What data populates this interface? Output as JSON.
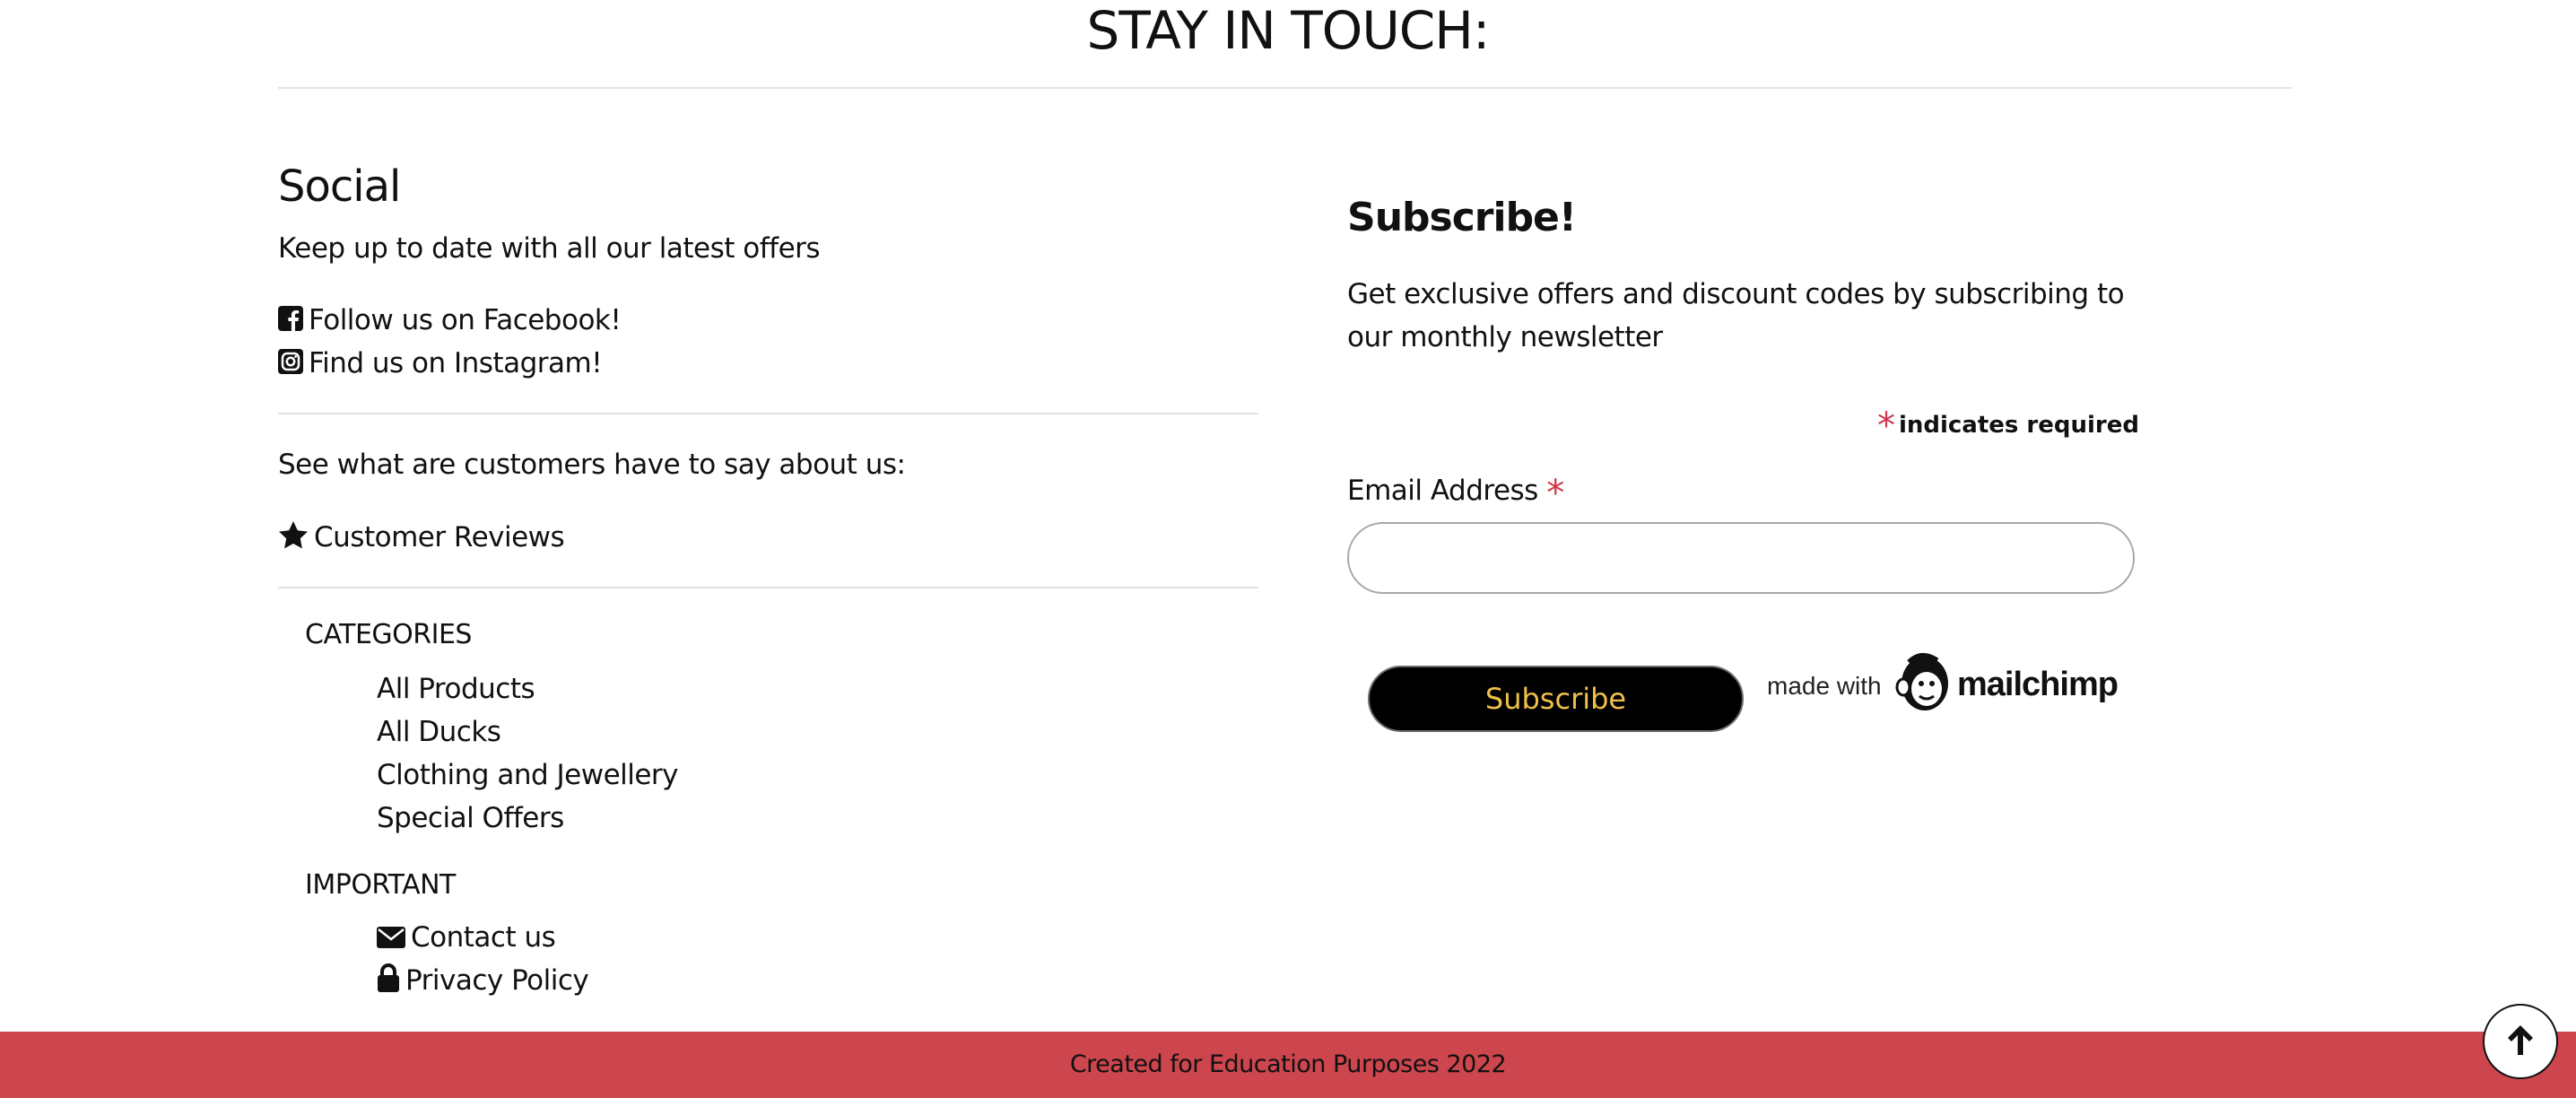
{
  "page": {
    "title": "STAY IN TOUCH:"
  },
  "social": {
    "heading": "Social",
    "tagline": "Keep up to date with all our latest offers",
    "links": [
      {
        "icon": "facebook-icon",
        "label": "Follow us on Facebook!"
      },
      {
        "icon": "instagram-icon",
        "label": "Find us on Instagram!"
      }
    ],
    "reviews_prompt": "See what are customers have to say about us:",
    "reviews_link": {
      "icon": "star-icon",
      "label": "Customer Reviews"
    }
  },
  "categories": {
    "heading": "CATEGORIES",
    "items": [
      "All Products",
      "All Ducks",
      "Clothing and Jewellery",
      "Special Offers"
    ]
  },
  "important": {
    "heading": "IMPORTANT",
    "items": [
      {
        "icon": "envelope-icon",
        "label": "Contact us"
      },
      {
        "icon": "lock-icon",
        "label": "Privacy Policy"
      }
    ]
  },
  "subscribe": {
    "heading": "Subscribe!",
    "description": "Get exclusive offers and discount codes by subscribing to our monthly newsletter",
    "required_marker": "*",
    "required_note": "indicates required",
    "email_label": "Email Address",
    "email_value": "",
    "button_label": "Subscribe",
    "made_with": "made with",
    "brand": "mailchimp"
  },
  "footer": {
    "text": "Created for Education Purposes 2022"
  },
  "colors": {
    "footer_bg": "#cd454d",
    "button_bg": "#000000",
    "button_text": "#f1c04a",
    "required_star": "#d0374a"
  },
  "back_to_top": {
    "icon": "arrow-up-icon"
  }
}
